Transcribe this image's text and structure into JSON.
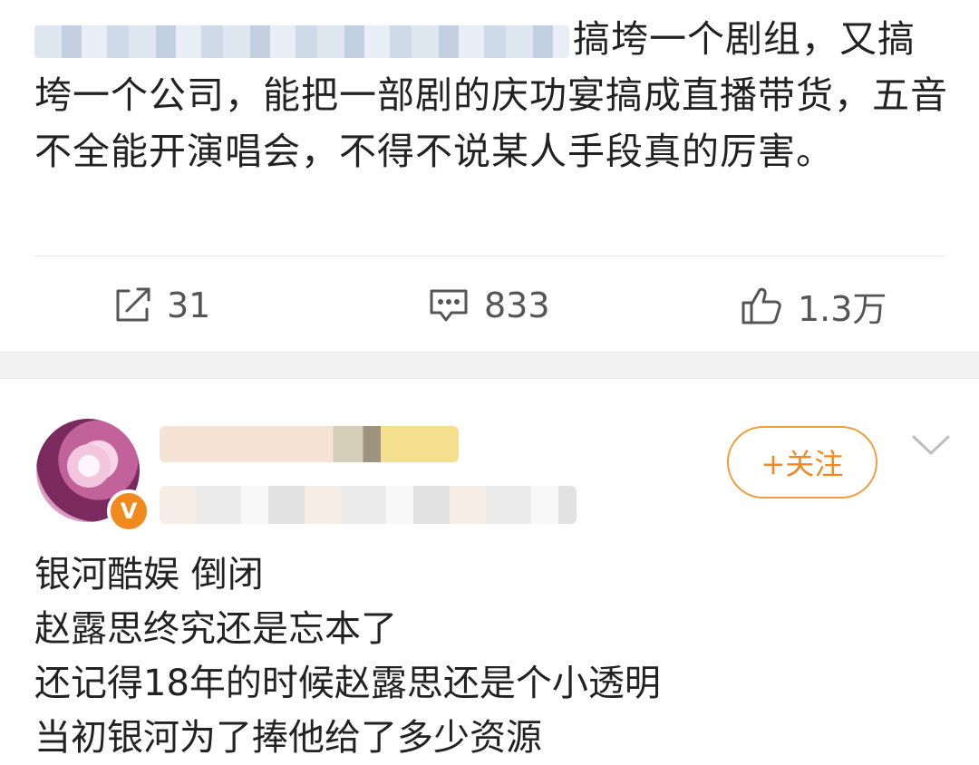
{
  "post1": {
    "text": "搞垮一个剧组，又搞垮一个公司，能把一部剧的庆功宴搞成直播带货，五音不全能开演唱会，不得不说某人手段真的厉害。",
    "repost_count": "31",
    "comment_count": "833",
    "like_count": "1.3万"
  },
  "post2": {
    "verified_badge": "V",
    "follow_label": "+关注",
    "lines": [
      "银河酷娱 倒闭",
      "赵露思终究还是忘本了",
      "还记得18年的时候赵露思还是个小透明",
      "当初银河为了捧他给了多少资源"
    ]
  },
  "colors": {
    "accent": "#f08a1f",
    "text": "#222222",
    "muted": "#555555",
    "band": "#f2f2f2"
  },
  "icons": {
    "repost": "repost-icon",
    "comment": "comment-icon",
    "like": "like-icon",
    "more": "chevron-down-icon"
  }
}
